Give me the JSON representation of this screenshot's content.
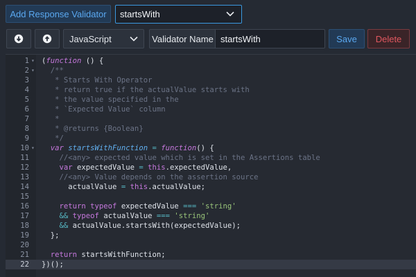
{
  "top": {
    "add_button": "Add Response Validator",
    "selected_validator": "startsWith"
  },
  "toolbar": {
    "language": "JavaScript",
    "validator_name_label": "Validator Name",
    "validator_name_value": "startsWith",
    "save_label": "Save",
    "delete_label": "Delete"
  },
  "editor": {
    "active_line": 22,
    "lines": [
      {
        "n": "1",
        "fold": true,
        "tokens": [
          [
            "c-paren",
            "("
          ],
          [
            "c-kwi",
            "function"
          ],
          [
            "c-punc",
            " () {"
          ]
        ]
      },
      {
        "n": "2",
        "fold": true,
        "tokens": [
          [
            "c-cm",
            "  /**"
          ]
        ]
      },
      {
        "n": "3",
        "fold": false,
        "tokens": [
          [
            "c-cm",
            "   * Starts With Operator"
          ]
        ]
      },
      {
        "n": "4",
        "fold": false,
        "tokens": [
          [
            "c-cm",
            "   * return true if the actualValue starts with"
          ]
        ]
      },
      {
        "n": "5",
        "fold": false,
        "tokens": [
          [
            "c-cm",
            "   * the value specified in the"
          ]
        ]
      },
      {
        "n": "6",
        "fold": false,
        "tokens": [
          [
            "c-cm",
            "   * `Expected Value` column"
          ]
        ]
      },
      {
        "n": "7",
        "fold": false,
        "tokens": [
          [
            "c-cm",
            "   *"
          ]
        ]
      },
      {
        "n": "8",
        "fold": false,
        "tokens": [
          [
            "c-cm",
            "   * @returns {Boolean}"
          ]
        ]
      },
      {
        "n": "9",
        "fold": false,
        "tokens": [
          [
            "c-cm",
            "   */"
          ]
        ]
      },
      {
        "n": "10",
        "fold": true,
        "tokens": [
          [
            "c-kwi",
            "  var "
          ],
          [
            "c-fn",
            "startsWithFunction"
          ],
          [
            "c-op",
            " = "
          ],
          [
            "c-kwi",
            "function"
          ],
          [
            "c-punc",
            "() {"
          ]
        ]
      },
      {
        "n": "11",
        "fold": false,
        "tokens": [
          [
            "c-cm",
            "    //<any> expected value which is set in the Assertions table"
          ]
        ]
      },
      {
        "n": "12",
        "fold": false,
        "tokens": [
          [
            "c-kw",
            "    var "
          ],
          [
            "c-punc",
            "expectedValue "
          ],
          [
            "c-op",
            "= "
          ],
          [
            "c-this",
            "this"
          ],
          [
            "c-punc",
            ".expectedValue,"
          ]
        ]
      },
      {
        "n": "13",
        "fold": false,
        "tokens": [
          [
            "c-cm",
            "    //<any> Value depends on the assertion source"
          ]
        ]
      },
      {
        "n": "14",
        "fold": false,
        "tokens": [
          [
            "c-punc",
            "      actualValue "
          ],
          [
            "c-op",
            "= "
          ],
          [
            "c-this",
            "this"
          ],
          [
            "c-punc",
            ".actualValue;"
          ]
        ]
      },
      {
        "n": "15",
        "fold": false,
        "tokens": []
      },
      {
        "n": "16",
        "fold": false,
        "tokens": [
          [
            "c-kw",
            "    return typeof "
          ],
          [
            "c-punc",
            "expectedValue "
          ],
          [
            "c-op",
            "=== "
          ],
          [
            "c-str",
            "'string'"
          ]
        ]
      },
      {
        "n": "17",
        "fold": false,
        "tokens": [
          [
            "c-op",
            "    && "
          ],
          [
            "c-kw",
            "typeof "
          ],
          [
            "c-punc",
            "actualValue "
          ],
          [
            "c-op",
            "=== "
          ],
          [
            "c-str",
            "'string'"
          ]
        ]
      },
      {
        "n": "18",
        "fold": false,
        "tokens": [
          [
            "c-op",
            "    && "
          ],
          [
            "c-punc",
            "actualValue.startsWith(expectedValue);"
          ]
        ]
      },
      {
        "n": "19",
        "fold": false,
        "tokens": [
          [
            "c-punc",
            "  };"
          ]
        ]
      },
      {
        "n": "20",
        "fold": false,
        "tokens": []
      },
      {
        "n": "21",
        "fold": false,
        "tokens": [
          [
            "c-kw",
            "  return "
          ],
          [
            "c-punc",
            "startsWithFunction;"
          ]
        ]
      },
      {
        "n": "22",
        "fold": false,
        "tokens": [
          [
            "c-punc",
            "})();"
          ]
        ]
      }
    ]
  },
  "icons": {
    "move_down": "arrow-down-circle-icon",
    "move_up": "arrow-up-circle-icon",
    "chevron": "chevron-down-icon"
  },
  "colors": {
    "background": "#252a33",
    "primary_text": "#5aa8f0",
    "danger_text": "#e0575f",
    "focus_border": "#3a99e0"
  }
}
